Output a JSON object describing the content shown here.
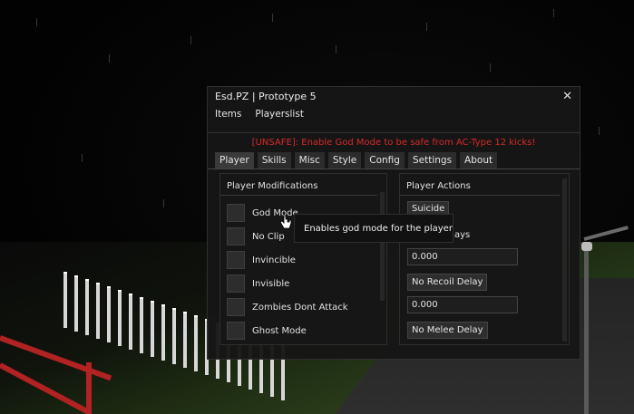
{
  "window": {
    "title": "Esd.PZ | Prototype 5",
    "close_glyph": "✕"
  },
  "menubar": {
    "items": [
      "Items",
      "Playerslist"
    ]
  },
  "warning": "[UNSAFE]: Enable God Mode to be safe from AC-Type 12 kicks!",
  "tabs": [
    "Player",
    "Skills",
    "Misc",
    "Style",
    "Config",
    "Settings",
    "About"
  ],
  "active_tab": "Player",
  "left_panel": {
    "title": "Player Modifications",
    "items": [
      "God Mode",
      "No Clip",
      "Invincible",
      "Invisible",
      "Zombies Dont Attack",
      "Ghost Mode"
    ]
  },
  "right_panel": {
    "title": "Player Actions",
    "suicide_button": "Suicide",
    "delays_label": "ays",
    "recoil_value": "0.000",
    "recoil_button": "No Recoil Delay",
    "melee_value": "0.000",
    "melee_button": "No Melee Delay"
  },
  "tooltip": "Enables god mode for the player",
  "colors": {
    "warning": "#d72a2a",
    "window_bg": "#161616",
    "tab_bg": "#2c2c2c",
    "swing": "#b12222"
  }
}
